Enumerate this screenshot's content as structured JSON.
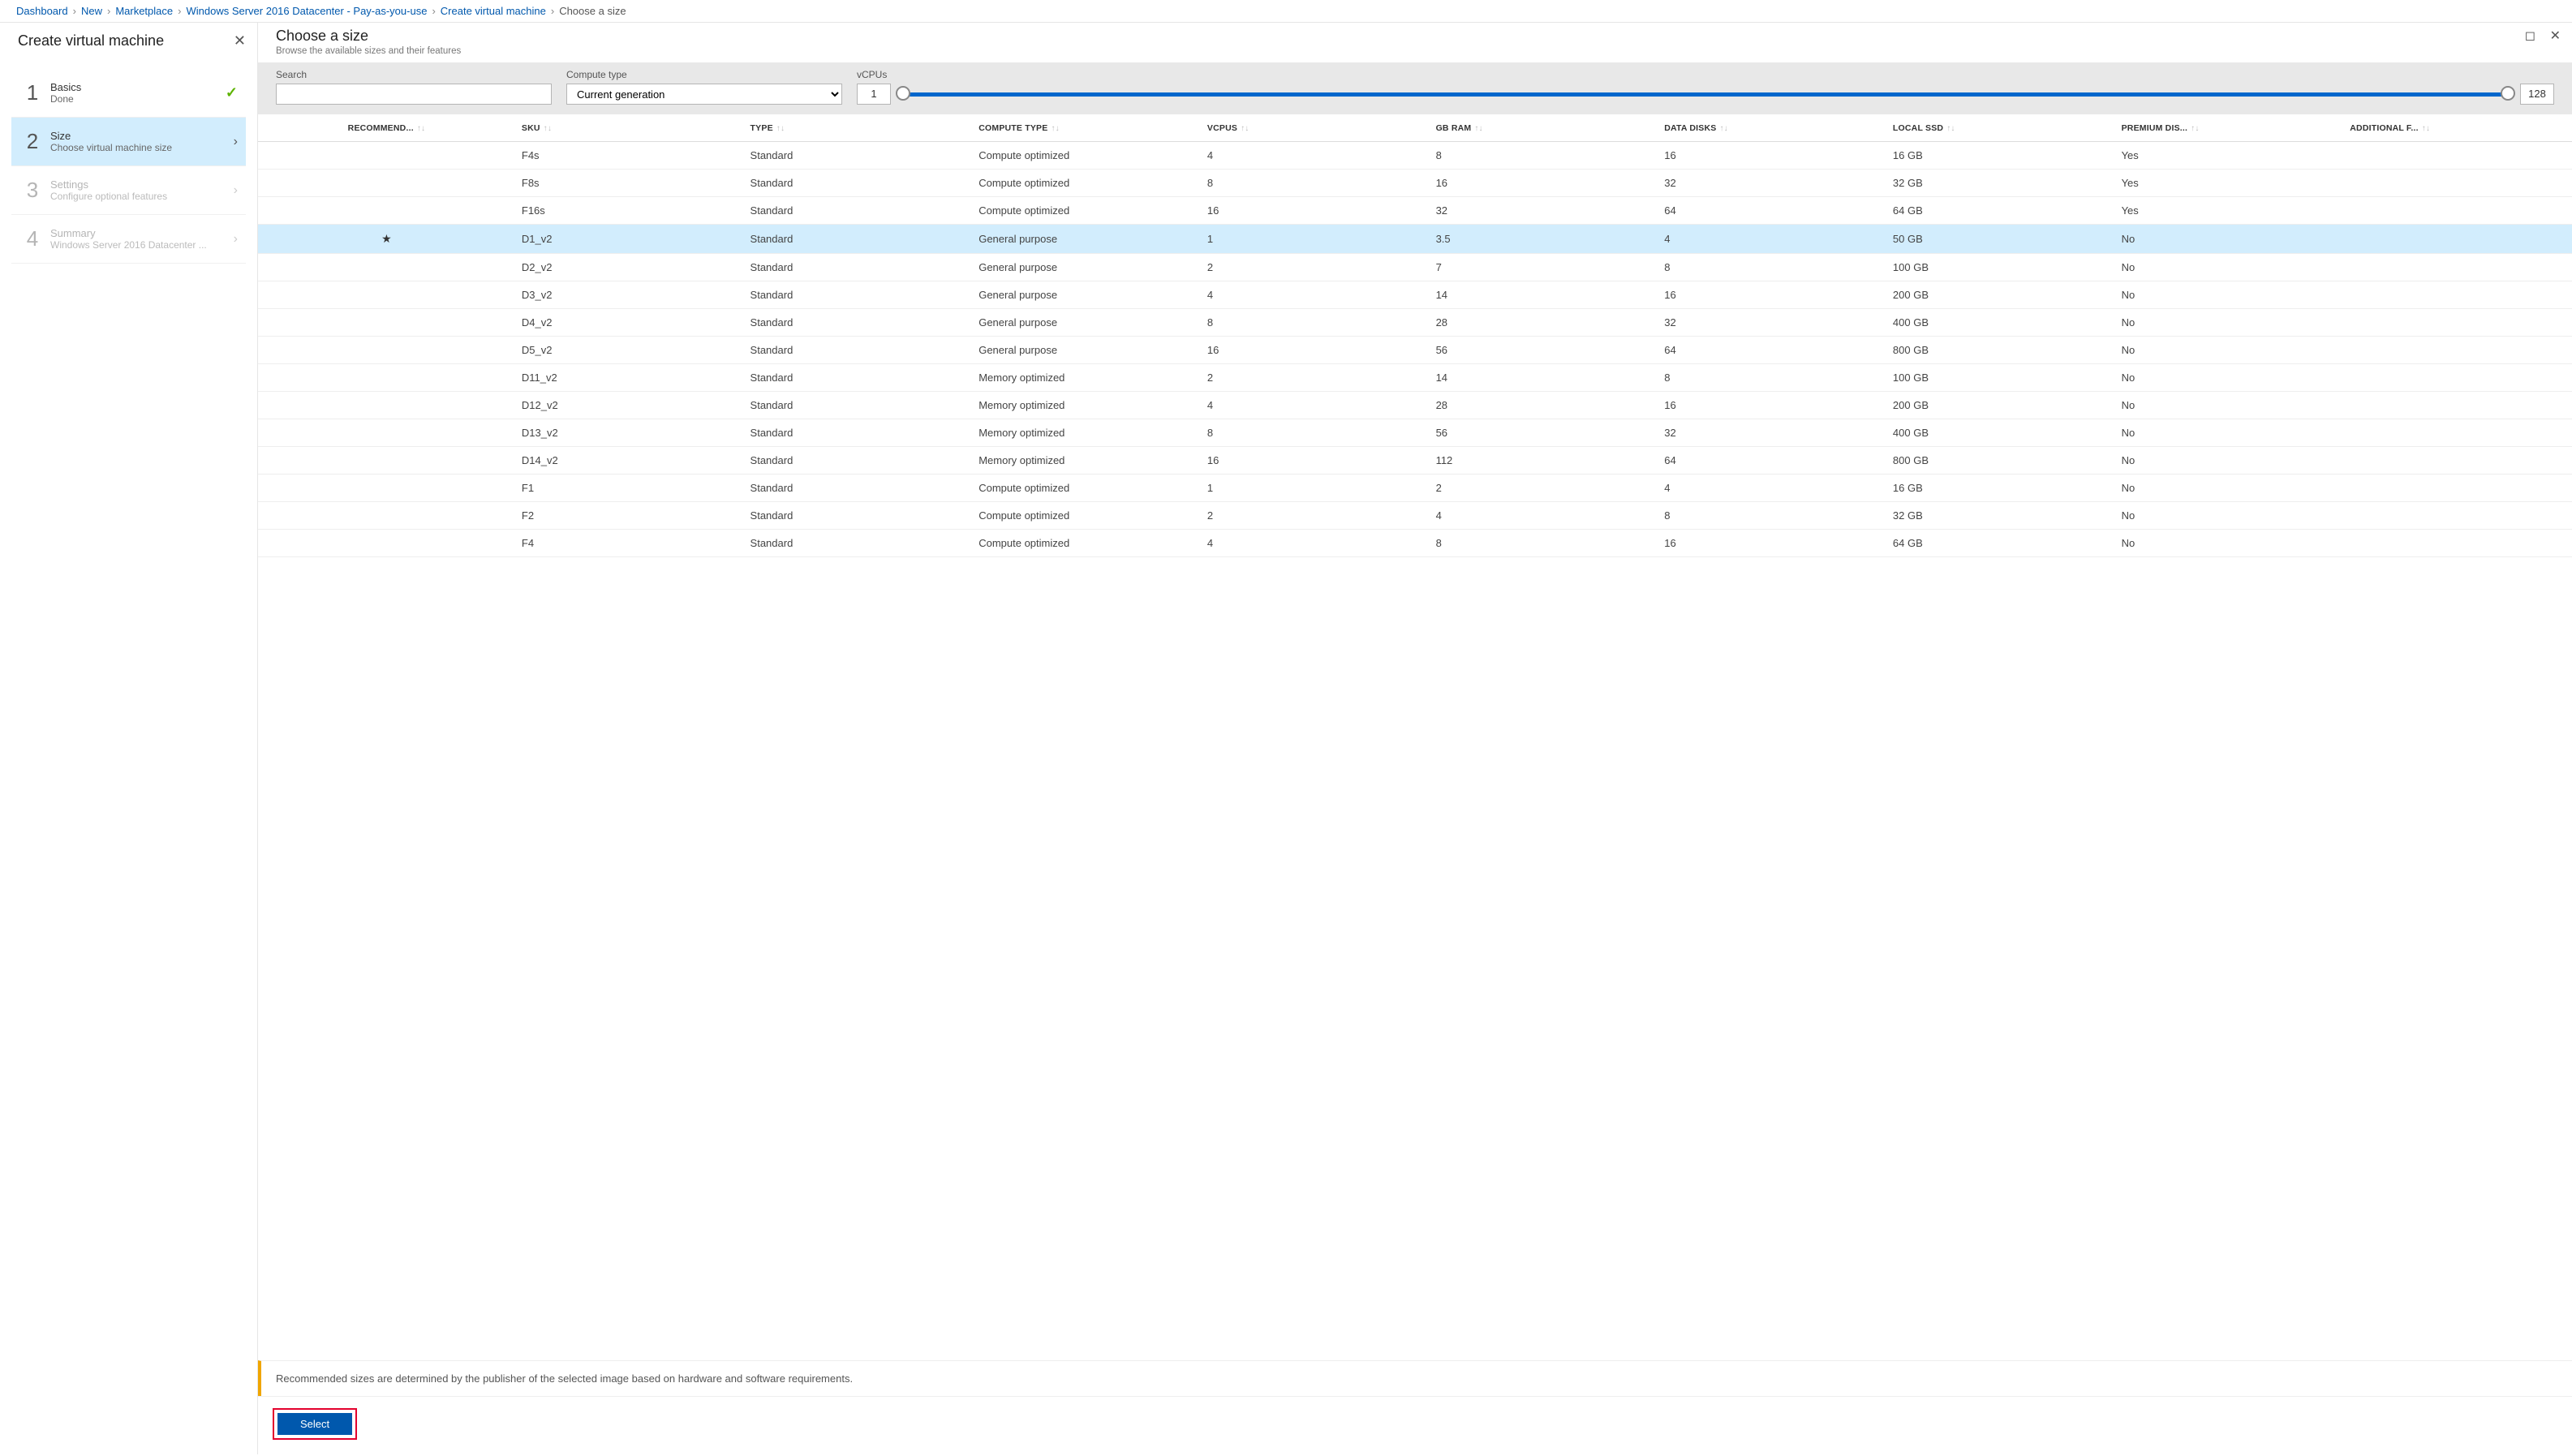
{
  "breadcrumb": {
    "items": [
      "Dashboard",
      "New",
      "Marketplace",
      "Windows Server 2016 Datacenter - Pay-as-you-use",
      "Create virtual machine"
    ],
    "current": "Choose a size"
  },
  "left": {
    "title": "Create virtual machine",
    "steps": [
      {
        "num": "1",
        "title": "Basics",
        "sub": "Done",
        "state": "done"
      },
      {
        "num": "2",
        "title": "Size",
        "sub": "Choose virtual machine size",
        "state": "active"
      },
      {
        "num": "3",
        "title": "Settings",
        "sub": "Configure optional features",
        "state": "disabled"
      },
      {
        "num": "4",
        "title": "Summary",
        "sub": "Windows Server 2016 Datacenter ...",
        "state": "disabled"
      }
    ]
  },
  "right": {
    "title": "Choose a size",
    "subtitle": "Browse the available sizes and their features"
  },
  "filters": {
    "search_label": "Search",
    "search_value": "",
    "compute_label": "Compute type",
    "compute_value": "Current generation",
    "vcpu_label": "vCPUs",
    "vcpu_min": "1",
    "vcpu_max": "128"
  },
  "columns": [
    "RECOMMEND...",
    "SKU",
    "TYPE",
    "COMPUTE TYPE",
    "VCPUS",
    "GB RAM",
    "DATA DISKS",
    "LOCAL SSD",
    "PREMIUM DIS...",
    "ADDITIONAL F..."
  ],
  "rows": [
    {
      "rec": "",
      "sku": "F4s",
      "type": "Standard",
      "ctype": "Compute optimized",
      "vcpu": "4",
      "ram": "8",
      "disks": "16",
      "ssd": "16 GB",
      "prem": "Yes"
    },
    {
      "rec": "",
      "sku": "F8s",
      "type": "Standard",
      "ctype": "Compute optimized",
      "vcpu": "8",
      "ram": "16",
      "disks": "32",
      "ssd": "32 GB",
      "prem": "Yes"
    },
    {
      "rec": "",
      "sku": "F16s",
      "type": "Standard",
      "ctype": "Compute optimized",
      "vcpu": "16",
      "ram": "32",
      "disks": "64",
      "ssd": "64 GB",
      "prem": "Yes"
    },
    {
      "rec": "★",
      "sku": "D1_v2",
      "type": "Standard",
      "ctype": "General purpose",
      "vcpu": "1",
      "ram": "3.5",
      "disks": "4",
      "ssd": "50 GB",
      "prem": "No",
      "selected": true
    },
    {
      "rec": "",
      "sku": "D2_v2",
      "type": "Standard",
      "ctype": "General purpose",
      "vcpu": "2",
      "ram": "7",
      "disks": "8",
      "ssd": "100 GB",
      "prem": "No"
    },
    {
      "rec": "",
      "sku": "D3_v2",
      "type": "Standard",
      "ctype": "General purpose",
      "vcpu": "4",
      "ram": "14",
      "disks": "16",
      "ssd": "200 GB",
      "prem": "No"
    },
    {
      "rec": "",
      "sku": "D4_v2",
      "type": "Standard",
      "ctype": "General purpose",
      "vcpu": "8",
      "ram": "28",
      "disks": "32",
      "ssd": "400 GB",
      "prem": "No"
    },
    {
      "rec": "",
      "sku": "D5_v2",
      "type": "Standard",
      "ctype": "General purpose",
      "vcpu": "16",
      "ram": "56",
      "disks": "64",
      "ssd": "800 GB",
      "prem": "No"
    },
    {
      "rec": "",
      "sku": "D11_v2",
      "type": "Standard",
      "ctype": "Memory optimized",
      "vcpu": "2",
      "ram": "14",
      "disks": "8",
      "ssd": "100 GB",
      "prem": "No"
    },
    {
      "rec": "",
      "sku": "D12_v2",
      "type": "Standard",
      "ctype": "Memory optimized",
      "vcpu": "4",
      "ram": "28",
      "disks": "16",
      "ssd": "200 GB",
      "prem": "No"
    },
    {
      "rec": "",
      "sku": "D13_v2",
      "type": "Standard",
      "ctype": "Memory optimized",
      "vcpu": "8",
      "ram": "56",
      "disks": "32",
      "ssd": "400 GB",
      "prem": "No"
    },
    {
      "rec": "",
      "sku": "D14_v2",
      "type": "Standard",
      "ctype": "Memory optimized",
      "vcpu": "16",
      "ram": "112",
      "disks": "64",
      "ssd": "800 GB",
      "prem": "No"
    },
    {
      "rec": "",
      "sku": "F1",
      "type": "Standard",
      "ctype": "Compute optimized",
      "vcpu": "1",
      "ram": "2",
      "disks": "4",
      "ssd": "16 GB",
      "prem": "No"
    },
    {
      "rec": "",
      "sku": "F2",
      "type": "Standard",
      "ctype": "Compute optimized",
      "vcpu": "2",
      "ram": "4",
      "disks": "8",
      "ssd": "32 GB",
      "prem": "No"
    },
    {
      "rec": "",
      "sku": "F4",
      "type": "Standard",
      "ctype": "Compute optimized",
      "vcpu": "4",
      "ram": "8",
      "disks": "16",
      "ssd": "64 GB",
      "prem": "No"
    }
  ],
  "footer_note": "Recommended sizes are determined by the publisher of the selected image based on hardware and software requirements.",
  "select_label": "Select"
}
